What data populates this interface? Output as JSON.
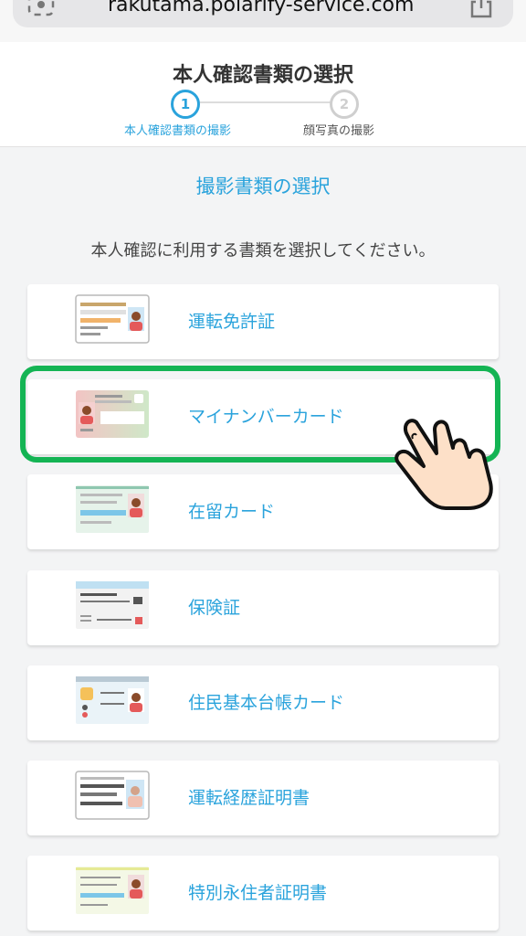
{
  "browser": {
    "url": "rakutama.polarify-service.com"
  },
  "header": {
    "title": "本人確認書類の選択",
    "steps": [
      {
        "number": "1",
        "label": "本人確認書類の撮影"
      },
      {
        "number": "2",
        "label": "顔写真の撮影"
      }
    ]
  },
  "main": {
    "section_title": "撮影書類の選択",
    "instruction": "本人確認に利用する書類を選択してください。",
    "documents": [
      {
        "label": "運転免許証"
      },
      {
        "label": "マイナンバーカード"
      },
      {
        "label": "在留カード"
      },
      {
        "label": "保険証"
      },
      {
        "label": "住民基本台帳カード"
      },
      {
        "label": "運転経歴証明書"
      },
      {
        "label": "特別永住者証明書"
      }
    ]
  },
  "colors": {
    "accent": "#2aa3dc",
    "highlight": "#14b454",
    "background": "#f3f4f5"
  },
  "icons": [
    "lens-icon",
    "share-icon",
    "id-card-icon",
    "hand-pointer-icon"
  ]
}
